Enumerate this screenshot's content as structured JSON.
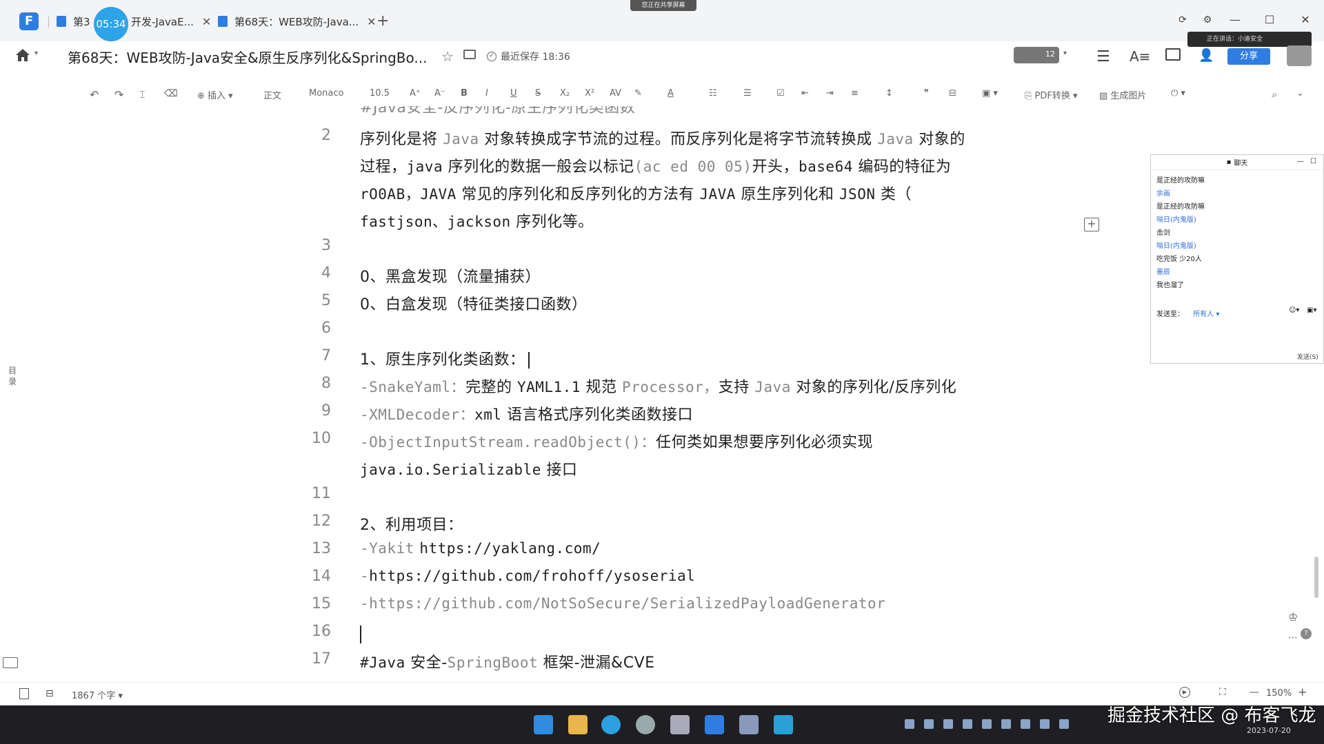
{
  "tabs": [
    {
      "label": "第3",
      "active": false
    },
    {
      "label": "开发-JavaE...",
      "active": true
    },
    {
      "label": "第68天：WEB攻防-Java...",
      "active": false
    }
  ],
  "timer": "05:34",
  "screen_share_banner": "您正在共享屏幕",
  "header": {
    "title": "第68天：WEB攻防-Java安全&原生反序列化&SpringBo...",
    "save_status": "最近保存 18:36",
    "avatar_count": "12",
    "share_label": "分享",
    "mic_status": "正在讲话：小迪安全"
  },
  "toolbar": {
    "insert": "插入",
    "style": "正文",
    "font": "Monaco",
    "size": "10.5",
    "pdf": "PDF转换",
    "gen_image": "生成图片"
  },
  "partial_top_text": "#Java安全-反序列化-原生序列化类函数",
  "lines": {
    "l2_a": "序列化是将",
    "l2_b": "Java",
    "l2_c": "对象转换成字节流的过程。而反序列化是将字节流转换成",
    "l2_d": "Java",
    "l2_e": "对象的",
    "l2b_a": "过程，",
    "l2b_b": "java",
    "l2b_c": "序列化的数据一般会以标记",
    "l2b_d": "(ac ed 00 05)",
    "l2b_e": "开头，",
    "l2b_f": "base64",
    "l2b_g": "编码的特征为",
    "l2c_a": "rO0AB，JAVA",
    "l2c_b": "常见的序列化和反序列化的方法有",
    "l2c_c": "JAVA",
    "l2c_d": "原生序列化和",
    "l2c_e": "JSON",
    "l2c_f": "类（",
    "l2d_a": "fastjson、jackson",
    "l2d_b": "序列化等。",
    "l4": "0、黑盒发现（流量捕获）",
    "l5": "0、白盒发现（特征类接口函数）",
    "l7": "1、原生序列化类函数：",
    "l8_a": "-SnakeYaml：",
    "l8_b": "完整的",
    "l8_c": "YAML1.1",
    "l8_d": "规范",
    "l8_e": "Processor，",
    "l8_f": "支持",
    "l8_g": "Java",
    "l8_h": "对象的序列化/反序列化",
    "l9_a": "-XMLDecoder：",
    "l9_b": "xml",
    "l9_c": "语言格式序列化类函数接口",
    "l10_a": "-ObjectInputStream.readObject()：",
    "l10_b": "任何类如果想要序列化必须实现",
    "l10b_a": "java.io.Serializable",
    "l10b_b": "接口",
    "l12": "2、利用项目：",
    "l13_a": "-Yakit",
    "l13_b": "https://yaklang.com/",
    "l14_a": "-",
    "l14_b": "https://github.com/frohoff/ysoserial",
    "l15_a": "-",
    "l15_b": "https://github.com/NotSoSecure/SerializedPayloadGenerator",
    "l17_a": "#Java",
    "l17_b": "安全-",
    "l17_c": "SpringBoot",
    "l17_d": "框架-泄漏&CVE"
  },
  "line_numbers": [
    "2",
    "3",
    "4",
    "5",
    "6",
    "7",
    "8",
    "9",
    "10",
    "11",
    "12",
    "13",
    "14",
    "15",
    "16",
    "17"
  ],
  "sidebar_toc": "目录",
  "chat": {
    "title": "聊天",
    "messages": [
      {
        "text": "是正经的攻防嘛",
        "color": "#222222"
      },
      {
        "text": "余画",
        "color": "#2f6fd6"
      },
      {
        "text": "是正经的攻防嘛",
        "color": "#222222"
      },
      {
        "text": "嗡日(内鬼版)",
        "color": "#2f6fd6"
      },
      {
        "text": "击剑",
        "color": "#222222"
      },
      {
        "text": "嗡日(内鬼版)",
        "color": "#2f6fd6"
      },
      {
        "text": "吃完饭 少20人",
        "color": "#222222"
      },
      {
        "text": "墨辰",
        "color": "#2f6fd6"
      },
      {
        "text": "我也溜了",
        "color": "#222222"
      }
    ],
    "send_to_label": "发送至：",
    "send_to_value": "所有人",
    "send_button": "发送(S)"
  },
  "status": {
    "word_count": "1867 个字",
    "zoom": "150%"
  },
  "taskbar": {
    "watermark": "掘金技术社区 @ 布客飞龙",
    "date": "2023-07-20"
  }
}
